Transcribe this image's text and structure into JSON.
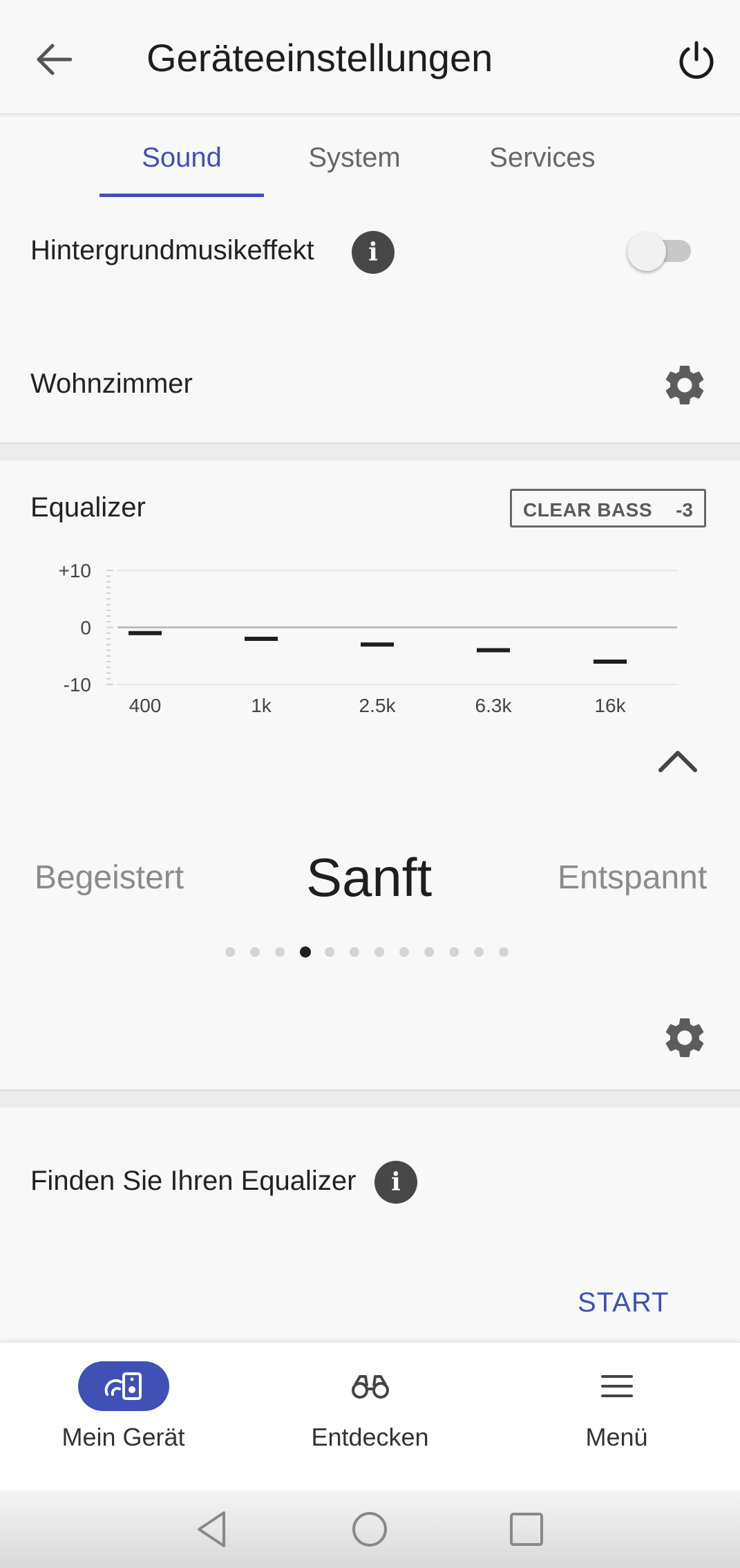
{
  "header": {
    "title": "Geräteeinstellungen",
    "back_icon": "arrow-left-icon",
    "power_icon": "power-icon"
  },
  "tabs": [
    {
      "label": "Sound",
      "active": true
    },
    {
      "label": "System",
      "active": false
    },
    {
      "label": "Services",
      "active": false
    }
  ],
  "background_music": {
    "label": "Hintergrundmusikeffekt",
    "info_icon": "i",
    "toggle_on": false
  },
  "room": {
    "label": "Wohnzimmer",
    "settings_icon": "gear-icon"
  },
  "equalizer": {
    "label": "Equalizer",
    "clear_bass_label": "CLEAR BASS",
    "clear_bass_value": "-3",
    "y_ticks": [
      "+10",
      "0",
      "-10"
    ],
    "bands": [
      {
        "freq": "400",
        "level": -1
      },
      {
        "freq": "1k",
        "level": -2
      },
      {
        "freq": "2.5k",
        "level": -3
      },
      {
        "freq": "6.3k",
        "level": -4
      },
      {
        "freq": "16k",
        "level": -6
      }
    ],
    "y_range": [
      -10,
      10
    ],
    "collapse_icon": "chevron-up-icon"
  },
  "presets": {
    "previous": "Begeistert",
    "current": "Sanft",
    "next": "Entspannt",
    "count": 12,
    "active_index": 3
  },
  "finder": {
    "label": "Finden Sie Ihren Equalizer",
    "info_icon": "i",
    "start_label": "START"
  },
  "bottom_nav": [
    {
      "label": "Mein Gerät",
      "icon": "speaker-device-icon",
      "active": true
    },
    {
      "label": "Entdecken",
      "icon": "binoculars-icon",
      "active": false
    },
    {
      "label": "Menü",
      "icon": "hamburger-menu-icon",
      "active": false
    }
  ],
  "colors": {
    "accent": "#3f51b5",
    "text": "#222222",
    "muted": "#8a8a8a"
  }
}
